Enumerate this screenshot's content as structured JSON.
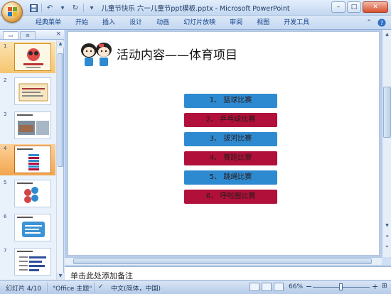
{
  "window": {
    "title": "儿童节快乐 六一儿童节ppt模板.pptx - Microsoft PowerPoint",
    "controls": [
      "–",
      "□",
      "✕"
    ]
  },
  "quick_access": {
    "icons": [
      "save-icon",
      "undo-icon",
      "redo-icon",
      "customize-icon"
    ]
  },
  "ribbon": {
    "tabs": [
      "经典菜单",
      "开始",
      "插入",
      "设计",
      "动画",
      "幻灯片放映",
      "审阅",
      "视图",
      "开发工具"
    ],
    "right_icons": [
      "minimize-ribbon-icon",
      "help-icon"
    ]
  },
  "slides_pane": {
    "tab_labels": [
      "▭",
      "≡"
    ],
    "close_label": "×",
    "thumbnails": [
      {
        "number": "1",
        "style": "selected"
      },
      {
        "number": "2",
        "style": "normal"
      },
      {
        "number": "3",
        "style": "normal"
      },
      {
        "number": "4",
        "style": "current"
      },
      {
        "number": "5",
        "style": "normal"
      },
      {
        "number": "6",
        "style": "normal"
      },
      {
        "number": "7",
        "style": "normal"
      }
    ]
  },
  "slide": {
    "title": "活动内容——体育项目",
    "items": [
      {
        "label": "1、 篮球比赛",
        "color": "#2e8ad0"
      },
      {
        "label": "2、 乒乓球比赛",
        "color": "#b0103a"
      },
      {
        "label": "3、 拔河比赛",
        "color": "#2e8ad0"
      },
      {
        "label": "4、 赛跑比赛",
        "color": "#b0103a"
      },
      {
        "label": "5、 跳绳比赛",
        "color": "#2e8ad0"
      },
      {
        "label": "6、 呼啦圈比赛",
        "color": "#b0103a"
      }
    ]
  },
  "notes": {
    "placeholder": "单击此处添加备注"
  },
  "statusbar": {
    "slide_indicator": "幻灯片 4/10",
    "theme": "\"Office 主题\"",
    "language": "中文(简体，中国)",
    "zoom": "66%",
    "zoom_minus": "−",
    "zoom_plus": "+"
  },
  "colors": {
    "accent_blue": "#2e8ad0",
    "accent_red": "#b0103a"
  }
}
